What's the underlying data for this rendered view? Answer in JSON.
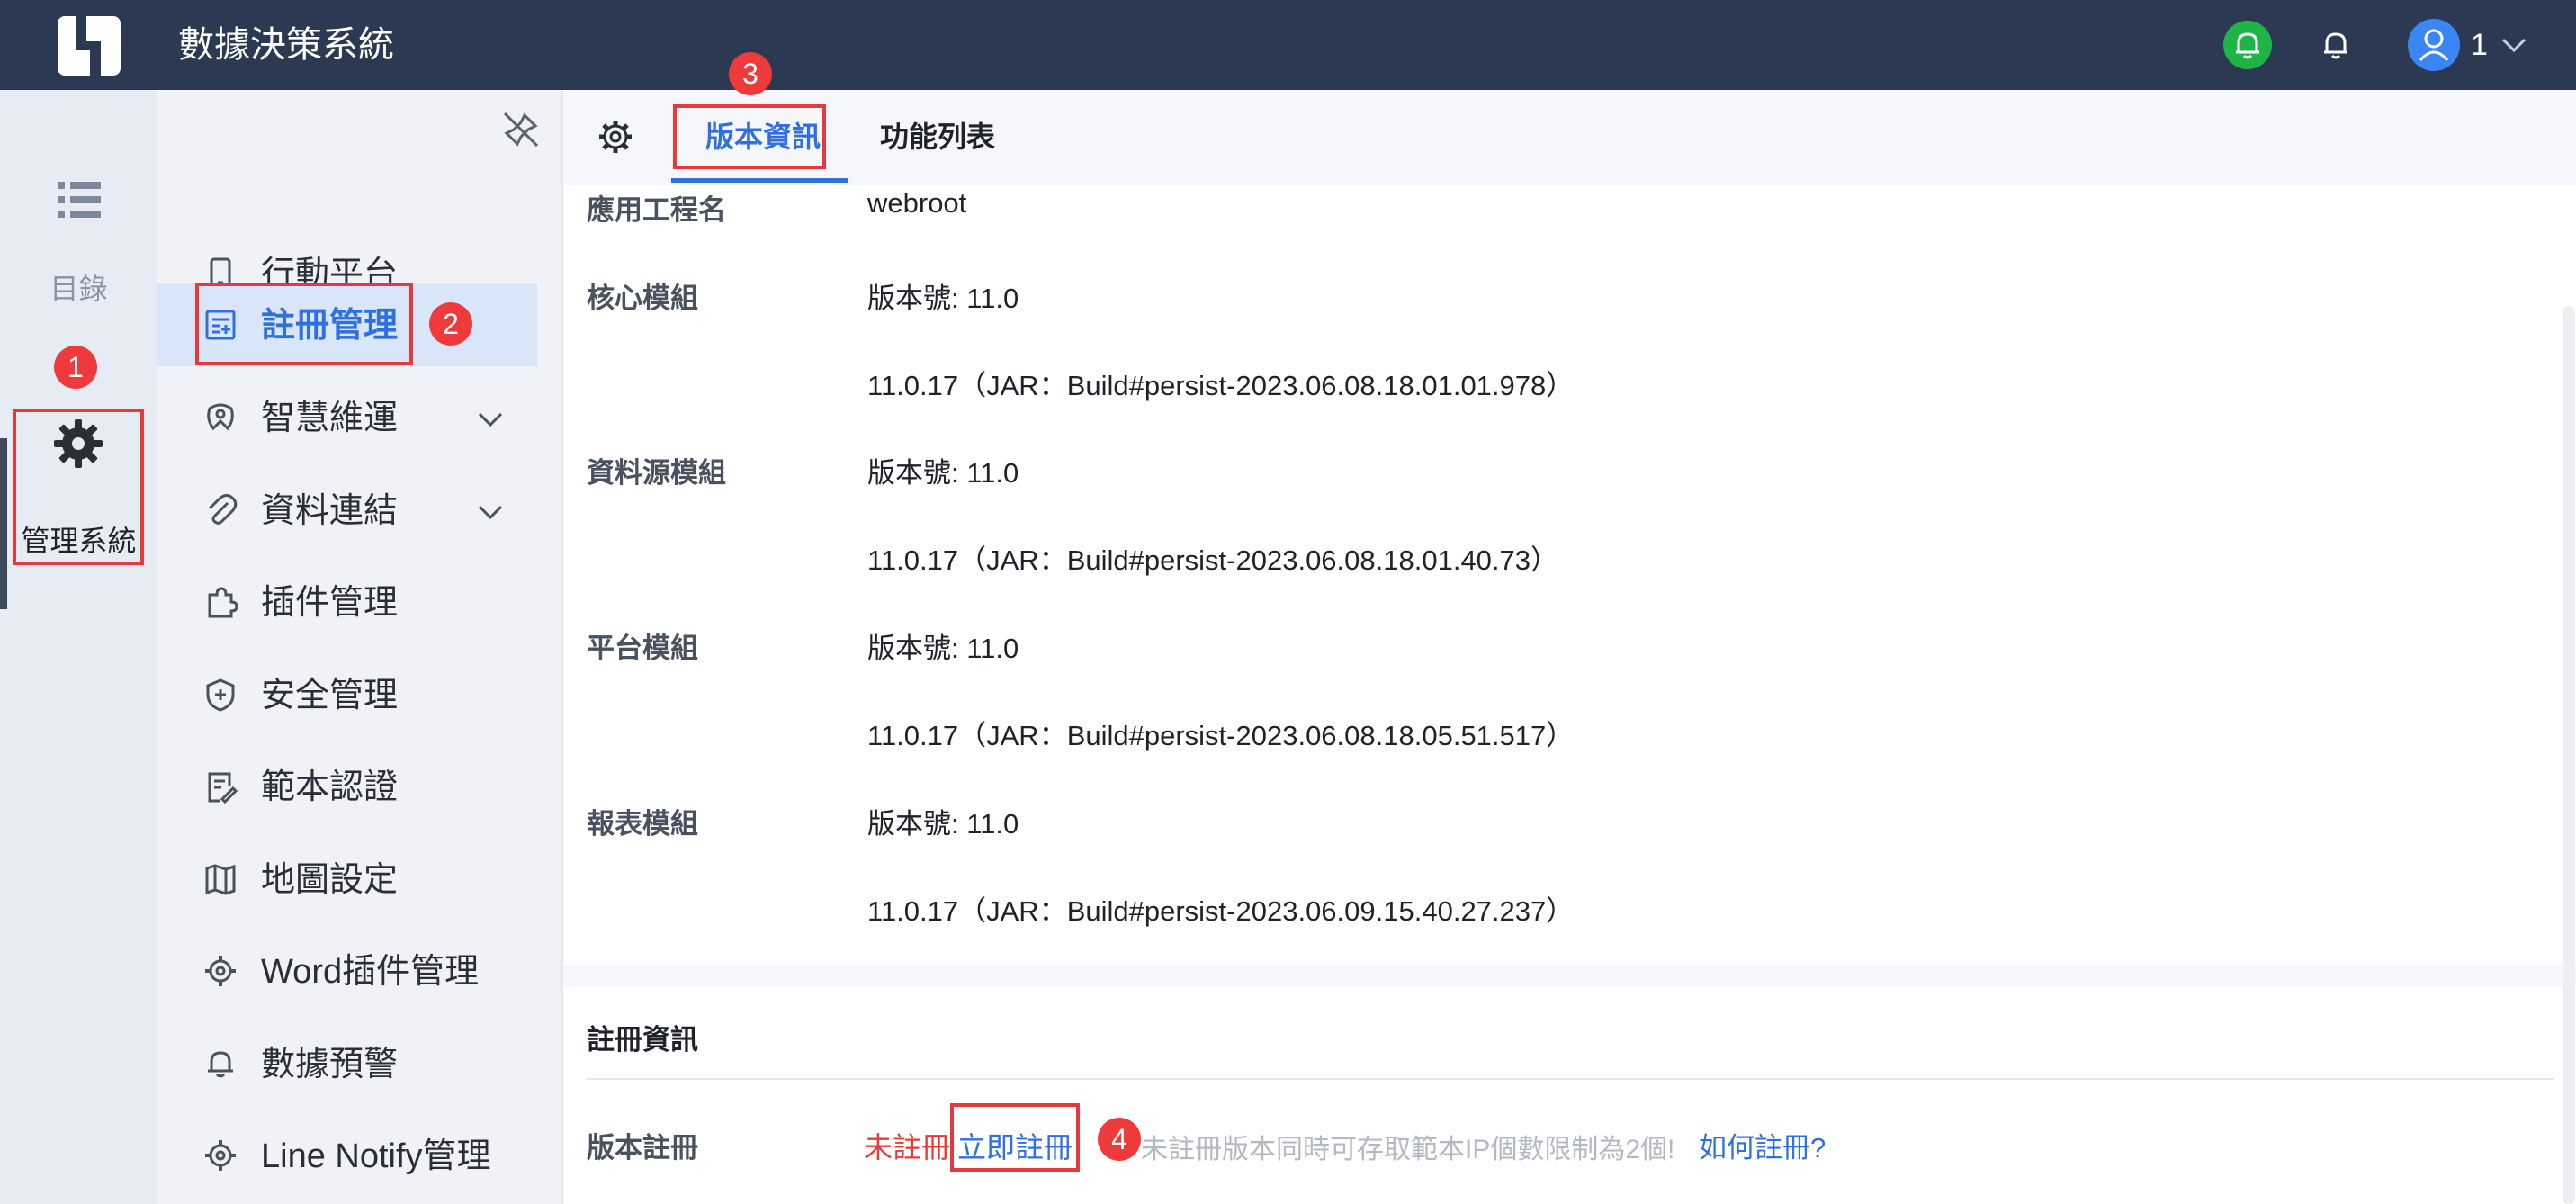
{
  "header": {
    "app_title": "數據決策系統",
    "user_name": "1",
    "icons": {
      "logo": "logo-icon",
      "notify_green": "bell-icon",
      "notify": "bell-icon",
      "avatar": "user-icon",
      "menu": "chevron-down-icon"
    }
  },
  "rail": {
    "directory_label": "目錄",
    "management_label": "管理系統"
  },
  "sidebar": {
    "items": [
      {
        "label": "行動平台",
        "icon": "mobile-icon"
      },
      {
        "label": "註冊管理",
        "icon": "register-icon"
      },
      {
        "label": "智慧維運",
        "icon": "maintenance-icon"
      },
      {
        "label": "資料連結",
        "icon": "paperclip-icon"
      },
      {
        "label": "插件管理",
        "icon": "puzzle-icon"
      },
      {
        "label": "安全管理",
        "icon": "shield-icon"
      },
      {
        "label": "範本認證",
        "icon": "certificate-icon"
      },
      {
        "label": "地圖設定",
        "icon": "map-icon"
      },
      {
        "label": "Word插件管理",
        "icon": "gear-icon"
      },
      {
        "label": "數據預警",
        "icon": "bell-icon"
      },
      {
        "label": "Line Notify管理",
        "icon": "gear-icon"
      }
    ]
  },
  "tabs": {
    "version_info": "版本資訊",
    "function_list": "功能列表"
  },
  "version_rows": [
    {
      "label": "應用工程名",
      "value": "webroot"
    },
    {
      "label": "核心模組",
      "value": "版本號: 11.0"
    },
    {
      "label": "",
      "value": "11.0.17（JAR：Build#persist-2023.06.08.18.01.01.978）"
    },
    {
      "label": "資料源模組",
      "value": "版本號: 11.0"
    },
    {
      "label": "",
      "value": "11.0.17（JAR：Build#persist-2023.06.08.18.01.40.73）"
    },
    {
      "label": "平台模組",
      "value": "版本號: 11.0"
    },
    {
      "label": "",
      "value": "11.0.17（JAR：Build#persist-2023.06.08.18.05.51.517）"
    },
    {
      "label": "報表模組",
      "value": "版本號: 11.0"
    },
    {
      "label": "",
      "value": "11.0.17（JAR：Build#persist-2023.06.09.15.40.27.237）"
    }
  ],
  "registration": {
    "section_title": "註冊資訊",
    "label": "版本註冊",
    "status": "未註冊",
    "register_now": "立即註冊",
    "note": "未註冊版本同時可存取範本IP個數限制為2個!",
    "how_to": "如何註冊?"
  },
  "badges": [
    "1",
    "2",
    "3",
    "4"
  ],
  "colors": {
    "header_bg": "#2b3a52",
    "accent_blue": "#2f6fe0",
    "highlight_red": "#e5393b",
    "active_item_bg": "#d9e6fa"
  }
}
